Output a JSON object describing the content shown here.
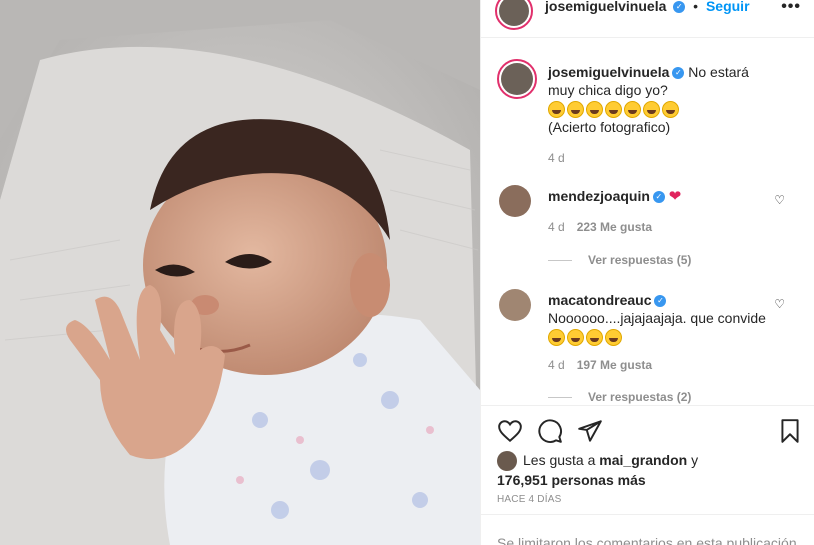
{
  "post": {
    "author": "josemiguelvinuela",
    "follow_label": "Seguir",
    "more_label": "•••"
  },
  "comments": [
    {
      "user": "josemiguelvinuela",
      "text": "No estará muy chica digo yo?",
      "emoji_count": 7,
      "text2": "(Acierto fotografico)",
      "time": "4 d"
    },
    {
      "user": "mendezjoaquin",
      "text": "",
      "heart": "❤",
      "time": "4 d",
      "likes": "223 Me gusta",
      "replies": "Ver respuestas (5)"
    },
    {
      "user": "macatondreauc",
      "text": "Noooooo....jajajaajaja. que convide",
      "emoji_count": 4,
      "time": "4 d",
      "likes": "197 Me gusta",
      "replies": "Ver respuestas (2)"
    }
  ],
  "likes": {
    "prefix": "Les gusta a",
    "user": "mai_grandon",
    "conj": "y",
    "count": "176,951 personas más"
  },
  "timestamp": "HACE 4 DÍAS",
  "limited": "Se limitaron los comentarios en esta publicación.",
  "icons": [
    "heart-icon",
    "comment-icon",
    "share-icon",
    "bookmark-icon"
  ]
}
